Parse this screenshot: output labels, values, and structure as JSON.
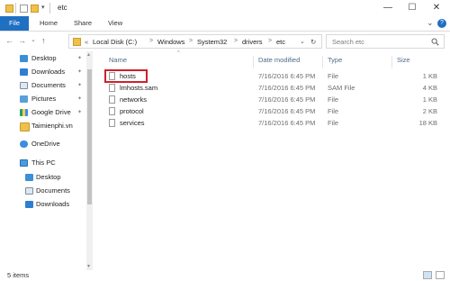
{
  "window": {
    "title": "etc",
    "controls": {
      "minimize": "—",
      "maximize": "☐",
      "close": "✕"
    }
  },
  "ribbon": {
    "tabs": [
      {
        "label": "File",
        "active": true
      },
      {
        "label": "Home"
      },
      {
        "label": "Share"
      },
      {
        "label": "View"
      }
    ],
    "expand_glyph": "⌄",
    "help_glyph": "?"
  },
  "address": {
    "back": "←",
    "forward": "→",
    "recent": "⌄",
    "up": "↑",
    "overflow": "«",
    "path": [
      "Local Disk (C:)",
      "Windows",
      "System32",
      "drivers",
      "etc"
    ],
    "separator": ">",
    "dropdown": "⌄",
    "refresh": "↻"
  },
  "search": {
    "placeholder": "Search etc",
    "icon": "search-icon"
  },
  "sidebar": {
    "items": [
      {
        "label": "Desktop",
        "pinned": true,
        "icon": "desktop-icon"
      },
      {
        "label": "Downloads",
        "pinned": true,
        "icon": "downloads-icon"
      },
      {
        "label": "Documents",
        "pinned": true,
        "icon": "documents-icon"
      },
      {
        "label": "Pictures",
        "pinned": true,
        "icon": "pictures-icon"
      },
      {
        "label": "Google Drive",
        "pinned": true,
        "icon": "google-drive-icon"
      },
      {
        "label": "Taimienphi.vn",
        "pinned": false,
        "icon": "folder-icon"
      },
      {
        "label": "OneDrive",
        "pinned": false,
        "icon": "onedrive-icon"
      },
      {
        "label": "This PC",
        "pinned": false,
        "icon": "computer-icon"
      },
      {
        "label": "Desktop",
        "pinned": false,
        "icon": "desktop-icon"
      },
      {
        "label": "Documents",
        "pinned": false,
        "icon": "documents-icon"
      },
      {
        "label": "Downloads",
        "pinned": false,
        "icon": "downloads-icon"
      }
    ],
    "pin_glyph": "✦"
  },
  "file_list": {
    "columns": [
      "Name",
      "Date modified",
      "Type",
      "Size"
    ],
    "sort_indicator": "^",
    "rows": [
      {
        "name": "hosts",
        "date": "7/16/2016 6:45 PM",
        "type": "File",
        "size": "1 KB",
        "highlighted": true
      },
      {
        "name": "lmhosts.sam",
        "date": "7/16/2016 6:45 PM",
        "type": "SAM File",
        "size": "4 KB"
      },
      {
        "name": "networks",
        "date": "7/16/2016 6:45 PM",
        "type": "File",
        "size": "1 KB"
      },
      {
        "name": "protocol",
        "date": "7/16/2016 6:45 PM",
        "type": "File",
        "size": "2 KB"
      },
      {
        "name": "services",
        "date": "7/16/2016 6:45 PM",
        "type": "File",
        "size": "18 KB"
      }
    ]
  },
  "status": {
    "items_count": "5 items"
  },
  "colors": {
    "accent": "#1f6fc3",
    "highlight_box": "#d0202a"
  }
}
